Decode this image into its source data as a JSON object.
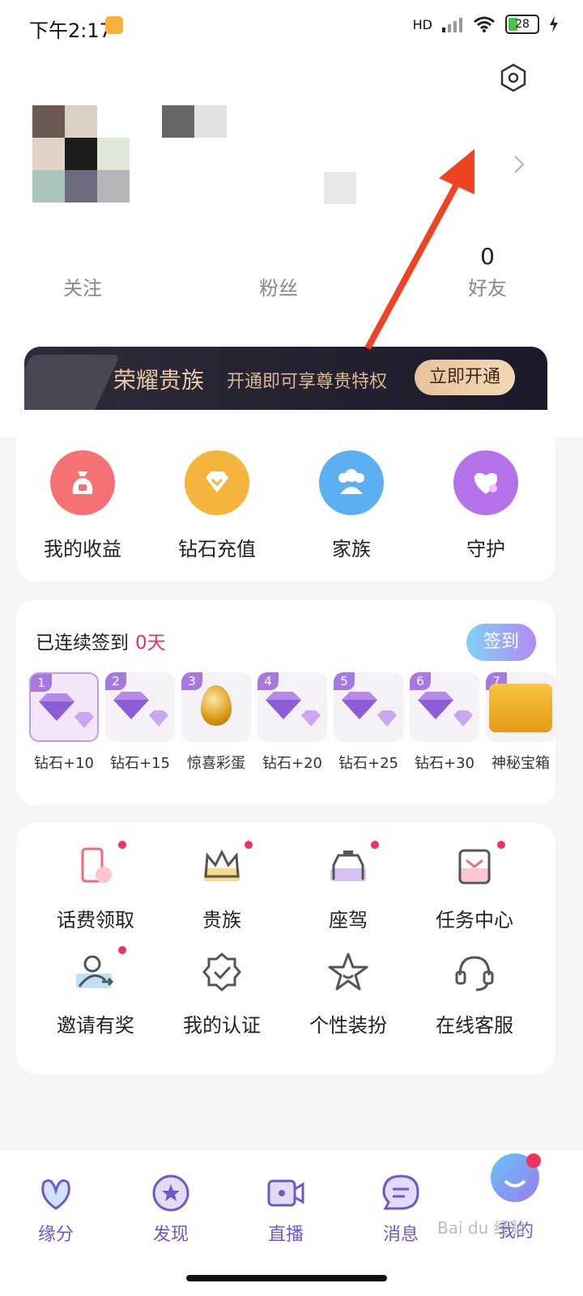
{
  "status_bar": {
    "time": "下午2:17",
    "network": "HD",
    "battery": "28"
  },
  "profile": {
    "stats": [
      {
        "num": "",
        "label": "关注"
      },
      {
        "num": "",
        "label": "粉丝"
      },
      {
        "num": "0",
        "label": "好友"
      }
    ]
  },
  "vip": {
    "title": "荣耀贵族",
    "subtitle": "开通即可享尊贵特权",
    "button": "立即开通"
  },
  "quick_actions": [
    {
      "label": "我的收益",
      "icon": "money-bag-icon",
      "color": "#f26a6e"
    },
    {
      "label": "钻石充值",
      "icon": "diamond-icon",
      "color": "#f3b038"
    },
    {
      "label": "家族",
      "icon": "group-icon",
      "color": "#5aa8ef"
    },
    {
      "label": "守护",
      "icon": "heart-icon",
      "color": "#b16ee8"
    }
  ],
  "signin": {
    "text": "已连续签到",
    "days": "0天",
    "button": "签到",
    "rewards": [
      {
        "day": "1",
        "label": "钻石+10"
      },
      {
        "day": "2",
        "label": "钻石+15"
      },
      {
        "day": "3",
        "label": "惊喜彩蛋"
      },
      {
        "day": "4",
        "label": "钻石+20"
      },
      {
        "day": "5",
        "label": "钻石+25"
      },
      {
        "day": "6",
        "label": "钻石+30"
      },
      {
        "day": "7",
        "label": "神秘宝箱"
      }
    ]
  },
  "tools": [
    {
      "label": "话费领取",
      "icon": "phone-bill-icon"
    },
    {
      "label": "贵族",
      "icon": "crown-icon"
    },
    {
      "label": "座驾",
      "icon": "car-icon"
    },
    {
      "label": "任务中心",
      "icon": "task-icon"
    },
    {
      "label": "邀请有奖",
      "icon": "invite-icon"
    },
    {
      "label": "我的认证",
      "icon": "verified-icon"
    },
    {
      "label": "个性装扮",
      "icon": "star-icon"
    },
    {
      "label": "在线客服",
      "icon": "headset-icon"
    }
  ],
  "tabs": [
    {
      "label": "缘分",
      "icon": "fate-icon"
    },
    {
      "label": "发现",
      "icon": "discover-icon"
    },
    {
      "label": "直播",
      "icon": "live-icon"
    },
    {
      "label": "消息",
      "icon": "message-icon"
    },
    {
      "label": "我的",
      "icon": "me-icon"
    }
  ],
  "watermark": "Bai du 经验"
}
